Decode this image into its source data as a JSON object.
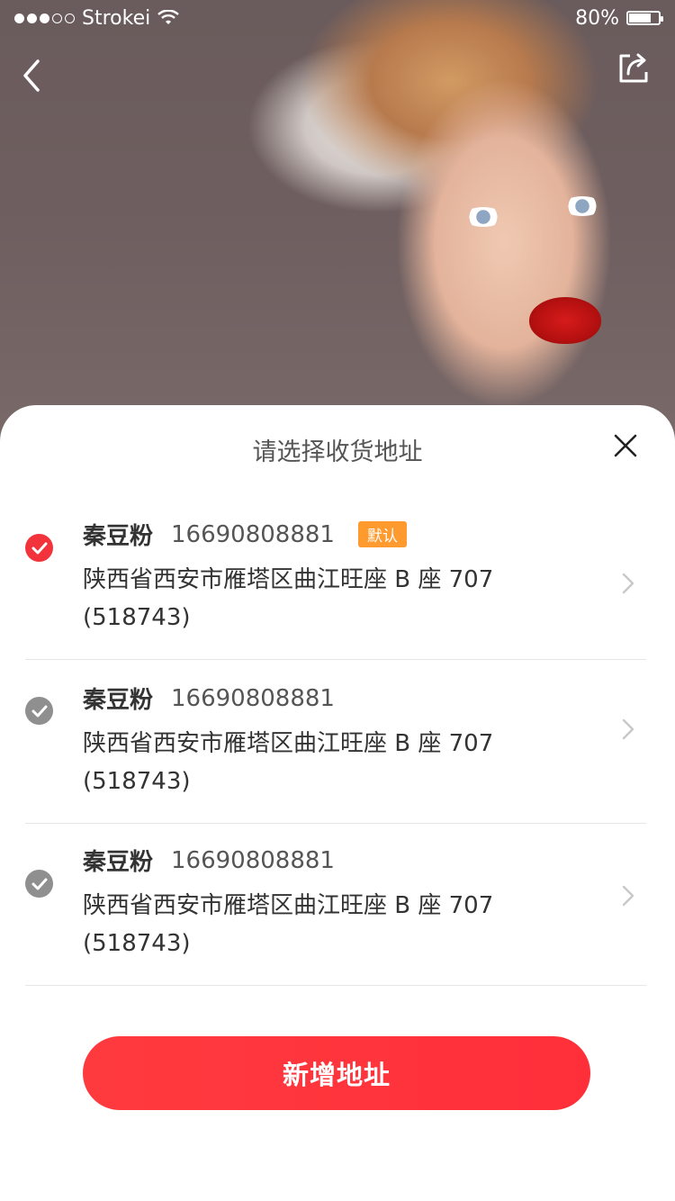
{
  "status_bar": {
    "carrier": "Strokei",
    "battery_percent": "80%",
    "battery_level": 0.8,
    "signal_bars_filled": 3,
    "signal_bars_total": 5
  },
  "nav": {
    "back_icon": "chevron-left-icon",
    "share_icon": "share-icon"
  },
  "sheet": {
    "title": "请选择收货地址",
    "close_icon": "close-icon"
  },
  "addresses": [
    {
      "name": "秦豆粉",
      "phone": "16690808881",
      "badge": "默认",
      "address": "陕西省西安市雁塔区曲江旺座 B 座 707",
      "postal": "(518743)",
      "selected": true
    },
    {
      "name": "秦豆粉",
      "phone": "16690808881",
      "address": "陕西省西安市雁塔区曲江旺座 B 座 707",
      "postal": "(518743)",
      "selected": false
    },
    {
      "name": "秦豆粉",
      "phone": "16690808881",
      "address": "陕西省西安市雁塔区曲江旺座 B 座 707",
      "postal": "(518743)",
      "selected": false
    }
  ],
  "add_button": {
    "label": "新增地址"
  },
  "colors": {
    "accent": "#f3333b",
    "badge": "#ff9a2e",
    "unselected": "#8f8f8f"
  }
}
